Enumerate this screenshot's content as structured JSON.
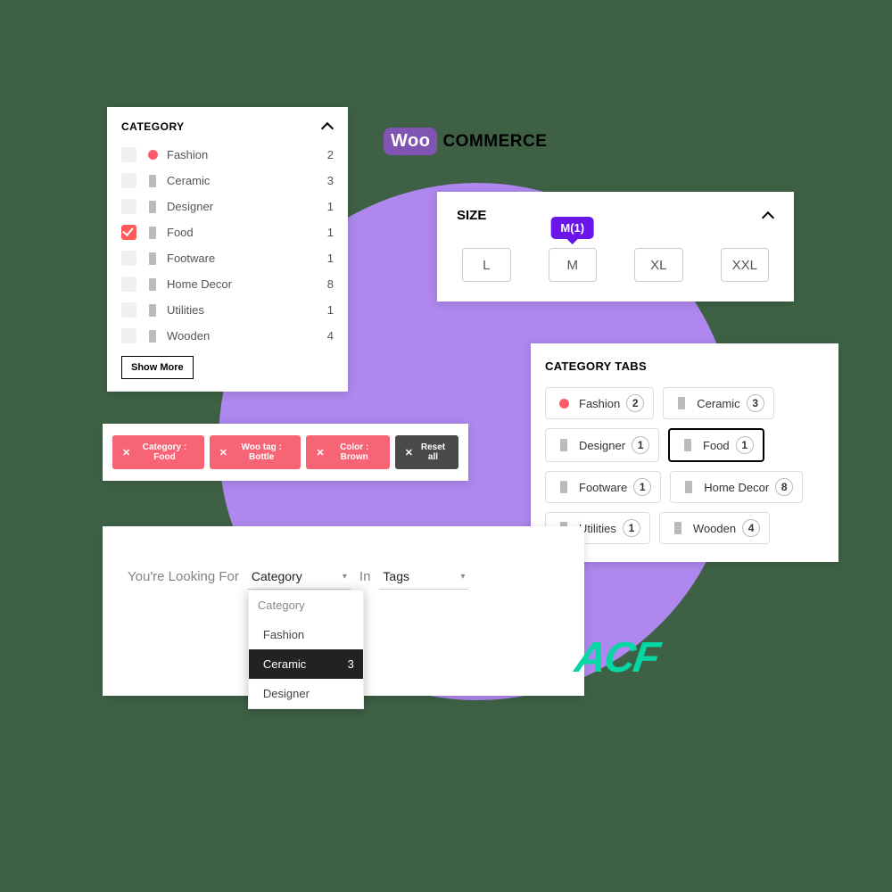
{
  "category_panel": {
    "title": "CATEGORY",
    "items": [
      {
        "label": "Fashion",
        "count": "2",
        "checked": false,
        "icon": "dot"
      },
      {
        "label": "Ceramic",
        "count": "3",
        "checked": false,
        "icon": "mini"
      },
      {
        "label": "Designer",
        "count": "1",
        "checked": false,
        "icon": "mini"
      },
      {
        "label": "Food",
        "count": "1",
        "checked": true,
        "icon": "mini"
      },
      {
        "label": "Footware",
        "count": "1",
        "checked": false,
        "icon": "mini"
      },
      {
        "label": "Home Decor",
        "count": "8",
        "checked": false,
        "icon": "mini"
      },
      {
        "label": "Utilities",
        "count": "1",
        "checked": false,
        "icon": "mini"
      },
      {
        "label": "Wooden",
        "count": "4",
        "checked": false,
        "icon": "mini"
      }
    ],
    "show_more": "Show More"
  },
  "woo_logo": {
    "bubble": "Woo",
    "text": "COMMERCE"
  },
  "size_panel": {
    "title": "SIZE",
    "tooltip": "M(1)",
    "options": [
      "L",
      "M",
      "XL",
      "XXL"
    ],
    "active": "M"
  },
  "active_filters": {
    "chips": [
      {
        "label": "Category : Food",
        "kind": "pink"
      },
      {
        "label": "Woo tag : Bottle",
        "kind": "pink"
      },
      {
        "label": "Color : Brown",
        "kind": "pink"
      },
      {
        "label": "Reset all",
        "kind": "dark"
      }
    ]
  },
  "tabs_panel": {
    "title": "CATEGORY TABS",
    "items": [
      {
        "label": "Fashion",
        "count": "2",
        "icon": "dot",
        "active": false
      },
      {
        "label": "Ceramic",
        "count": "3",
        "icon": "mini",
        "active": false
      },
      {
        "label": "Designer",
        "count": "1",
        "icon": "mini",
        "active": false
      },
      {
        "label": "Food",
        "count": "1",
        "icon": "mini",
        "active": true
      },
      {
        "label": "Footware",
        "count": "1",
        "icon": "mini",
        "active": false
      },
      {
        "label": "Home Decor",
        "count": "8",
        "icon": "mini",
        "active": false
      },
      {
        "label": "Utilities",
        "count": "1",
        "icon": "mini",
        "active": false
      },
      {
        "label": "Wooden",
        "count": "4",
        "icon": "mini",
        "active": false
      }
    ]
  },
  "search_panel": {
    "looking_for": "You're Looking For",
    "in": "In",
    "dd1_value": "Category",
    "dd2_value": "Tags",
    "menu": {
      "header": "Category",
      "items": [
        {
          "label": "Fashion",
          "count": "",
          "icon": "dot",
          "selected": false
        },
        {
          "label": "Ceramic",
          "count": "3",
          "icon": "mini",
          "selected": true
        },
        {
          "label": "Designer",
          "count": "",
          "icon": "mini",
          "selected": false
        }
      ]
    }
  },
  "acf_logo": "ACF"
}
